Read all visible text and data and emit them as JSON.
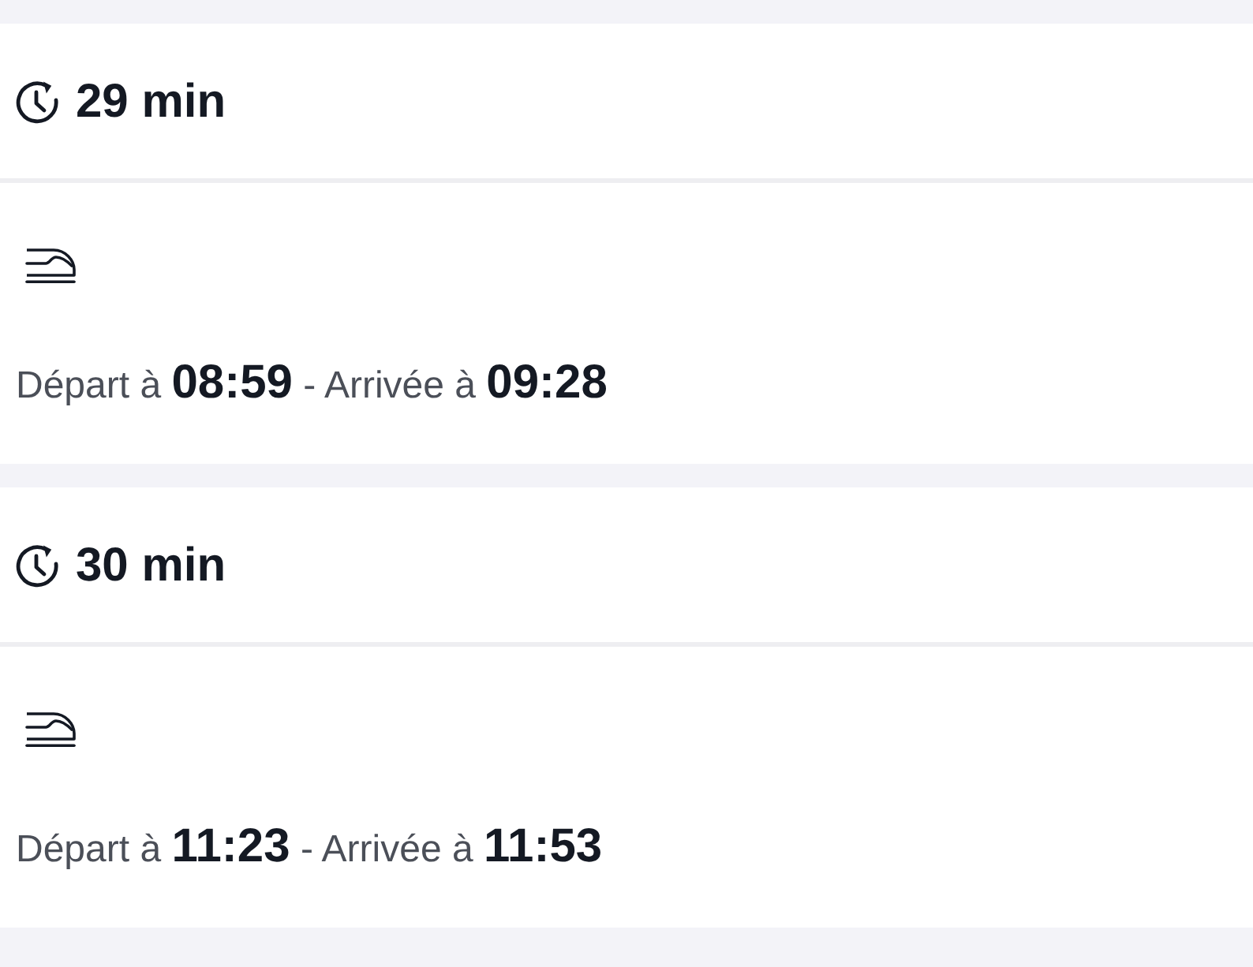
{
  "trips": [
    {
      "duration": "29 min",
      "segments": [
        {
          "kind": "train",
          "schedule": "Départ à **08:59** - Arrivée à **09:28**"
        }
      ]
    },
    {
      "duration": "30 min",
      "segments": [
        {
          "kind": "train",
          "schedule": "Départ à **11:23** - Arrivée à **11:53**"
        }
      ]
    }
  ]
}
